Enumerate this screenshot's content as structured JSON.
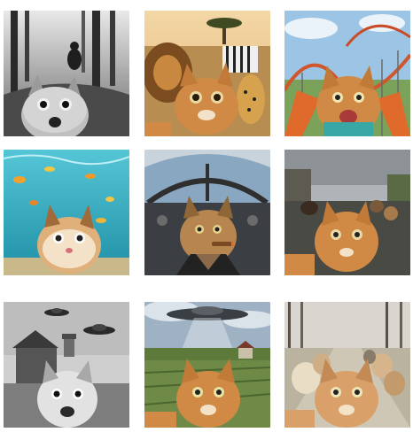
{
  "gallery": {
    "tiles": [
      {
        "subject": "cat-selfie-bigfoot-forest",
        "style": "grayscale"
      },
      {
        "subject": "cat-selfie-savanna-animals",
        "style": "color"
      },
      {
        "subject": "cat-selfie-rollercoaster",
        "style": "color"
      },
      {
        "subject": "cat-selfie-underwater",
        "style": "color"
      },
      {
        "subject": "cat-selfie-cockpit-cigar",
        "style": "color"
      },
      {
        "subject": "cat-selfie-running-dogs",
        "style": "color"
      },
      {
        "subject": "cat-selfie-farmhouse-ufos",
        "style": "grayscale"
      },
      {
        "subject": "cat-selfie-ufo-farmland",
        "style": "color"
      },
      {
        "subject": "cat-selfie-cat-pack-road",
        "style": "color"
      }
    ]
  },
  "colors": {
    "ginger": "#d08a45",
    "ginger_dark": "#9c5a25",
    "cream": "#f3e2c8",
    "sky": "#8fb7d8",
    "water": "#2aa7b7",
    "grass": "#5d7a3b"
  }
}
